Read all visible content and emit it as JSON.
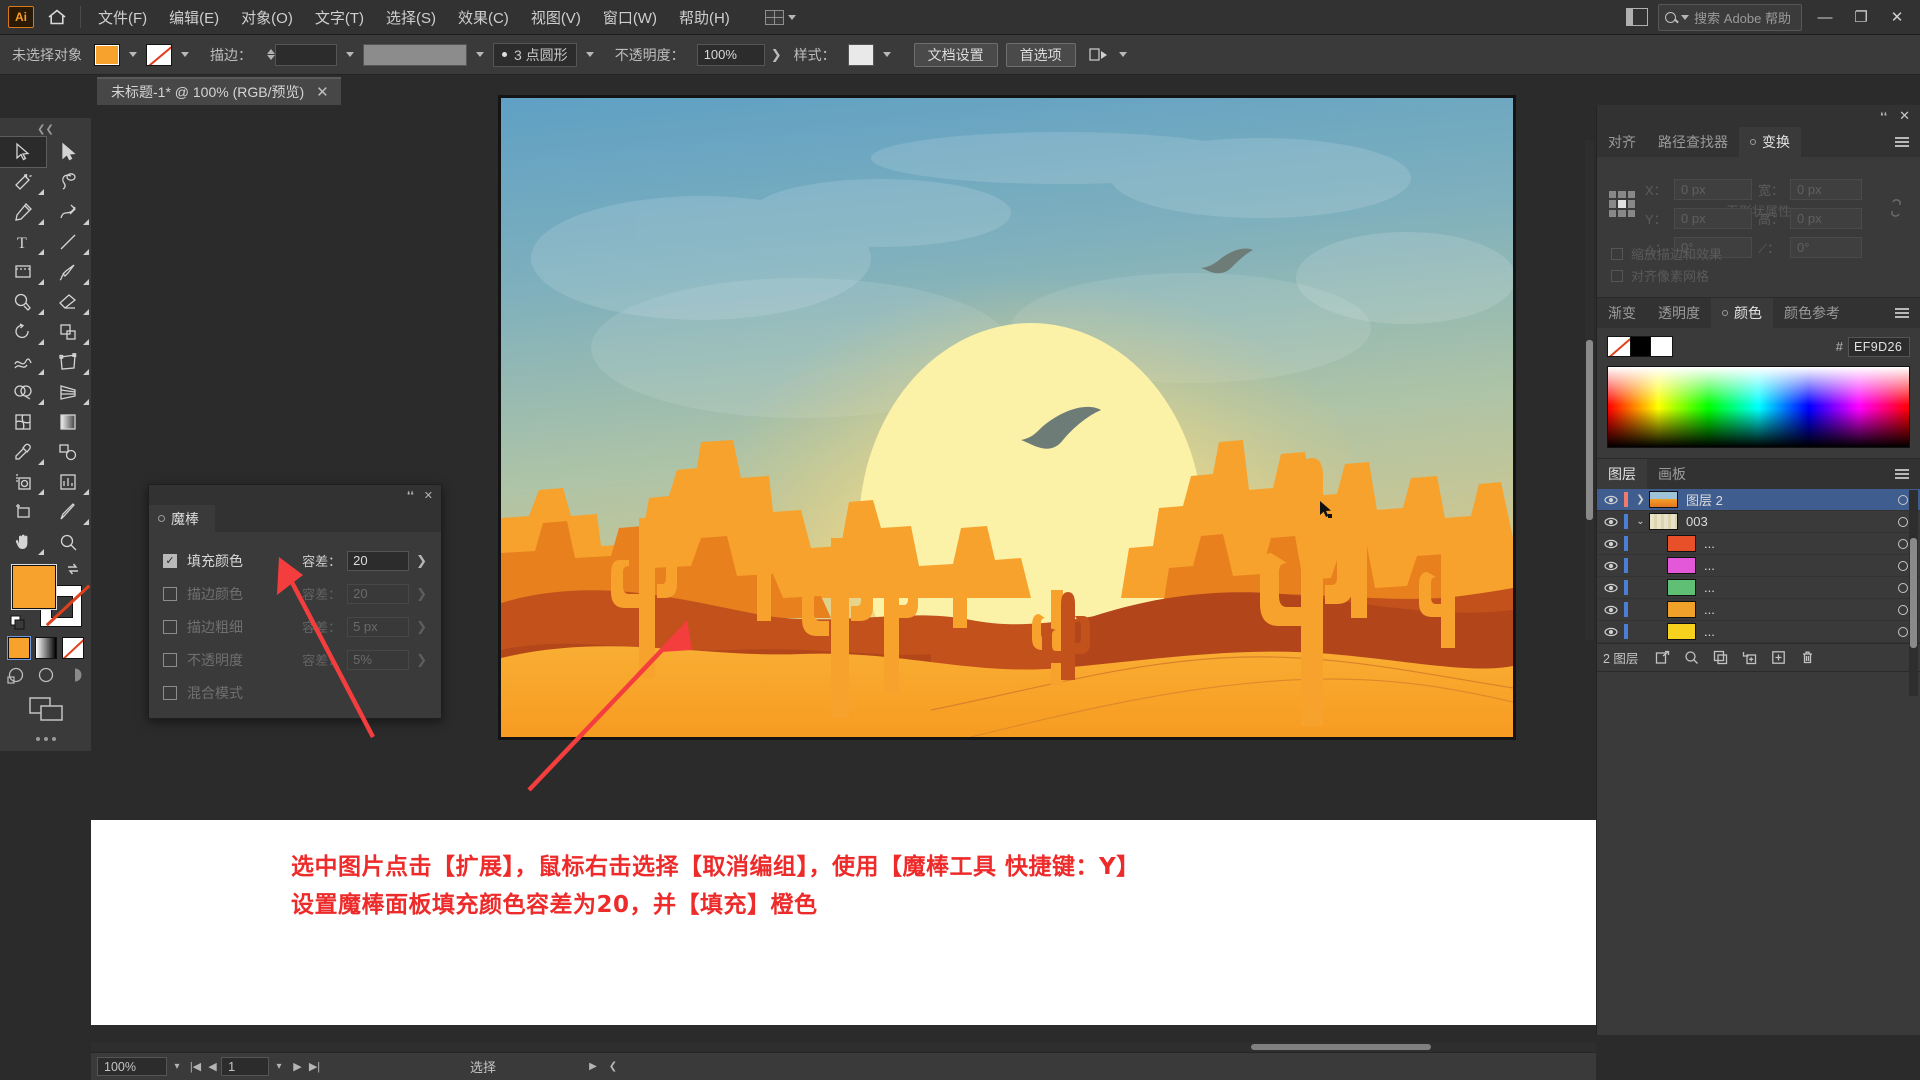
{
  "app": {
    "logo": "Ai",
    "home_icon": "home-icon",
    "workspace_icon": "workspace-grid-icon"
  },
  "menubar": {
    "items": [
      "文件(F)",
      "编辑(E)",
      "对象(O)",
      "文字(T)",
      "选择(S)",
      "效果(C)",
      "视图(V)",
      "窗口(W)",
      "帮助(H)"
    ],
    "search_placeholder": "搜索 Adobe 帮助",
    "window_buttons": [
      "—",
      "❐",
      "✕"
    ]
  },
  "controlbar": {
    "selection_status": "未选择对象",
    "fill_color": "#F7A22C",
    "stroke_label": "描边：",
    "stroke_weight": "",
    "profile_label": "3 点圆形",
    "opacity_label": "不透明度：",
    "opacity_value": "100%",
    "style_label": "样式：",
    "document_setup": "文档设置",
    "preferences": "首选项"
  },
  "document_tab": {
    "title": "未标题-1* @ 100% (RGB/预览)",
    "close": "✕"
  },
  "toolbar": {
    "tools": [
      {
        "name": "selection-tool",
        "selected": true
      },
      {
        "name": "direct-selection-tool",
        "selected": false
      },
      {
        "name": "magic-wand-tool",
        "selected": false
      },
      {
        "name": "lasso-tool",
        "selected": false
      },
      {
        "name": "pen-tool",
        "selected": false
      },
      {
        "name": "curvature-tool",
        "selected": false
      },
      {
        "name": "type-tool",
        "selected": false
      },
      {
        "name": "line-segment-tool",
        "selected": false
      },
      {
        "name": "rectangle-tool",
        "selected": false
      },
      {
        "name": "paintbrush-tool",
        "selected": false
      },
      {
        "name": "shaper-tool",
        "selected": false
      },
      {
        "name": "eraser-tool",
        "selected": false
      },
      {
        "name": "rotate-tool",
        "selected": false
      },
      {
        "name": "scale-tool",
        "selected": false
      },
      {
        "name": "width-tool",
        "selected": false
      },
      {
        "name": "free-transform-tool",
        "selected": false
      },
      {
        "name": "shape-builder-tool",
        "selected": false
      },
      {
        "name": "perspective-grid-tool",
        "selected": false
      },
      {
        "name": "mesh-tool",
        "selected": false
      },
      {
        "name": "gradient-tool",
        "selected": false
      },
      {
        "name": "eyedropper-tool",
        "selected": false
      },
      {
        "name": "blend-tool",
        "selected": false
      },
      {
        "name": "symbol-sprayer-tool",
        "selected": false
      },
      {
        "name": "column-graph-tool",
        "selected": false
      },
      {
        "name": "artboard-tool",
        "selected": false
      },
      {
        "name": "slice-tool",
        "selected": false
      },
      {
        "name": "hand-tool",
        "selected": false
      },
      {
        "name": "zoom-tool",
        "selected": false
      }
    ],
    "fill_color": "#F7A22C",
    "stroke_color": "none",
    "more_tools": "···"
  },
  "magic_wand_panel": {
    "tab_title": "魔棒",
    "collapse_icon": "collapse-icon",
    "close_icon": "✕",
    "rows": [
      {
        "label": "填充颜色",
        "checked": true,
        "tolerance_label": "容差：",
        "tolerance_value": "20",
        "enabled": true
      },
      {
        "label": "描边颜色",
        "checked": false,
        "tolerance_label": "容差：",
        "tolerance_value": "20",
        "enabled": false
      },
      {
        "label": "描边粗细",
        "checked": false,
        "tolerance_label": "容差：",
        "tolerance_value": "5 px",
        "enabled": false
      },
      {
        "label": "不透明度",
        "checked": false,
        "tolerance_label": "容差：",
        "tolerance_value": "5%",
        "enabled": false
      },
      {
        "label": "混合模式",
        "checked": false,
        "tolerance_label": "",
        "tolerance_value": "",
        "enabled": false
      }
    ]
  },
  "transform_panel": {
    "tabs": [
      "对齐",
      "路径查找器",
      "变换"
    ],
    "active_tab": "变换",
    "fields": {
      "x_label": "X：",
      "x_value": "0 px",
      "y_label": "Y：",
      "y_value": "0 px",
      "w_label": "宽：",
      "w_value": "0 px",
      "h_label": "高：",
      "h_value": "0 px",
      "angle_label": "△：",
      "angle_value": "0°",
      "shear_label": "⟋：",
      "shear_value": "0°"
    },
    "empty_text": "无形状属性",
    "scale_strokes": "缩放描边和效果",
    "align_pixel": "对齐像素网格",
    "link_icon": "link-broken-icon"
  },
  "color_panel": {
    "tabs": [
      "渐变",
      "透明度",
      "颜色",
      "颜色参考"
    ],
    "active_tab": "颜色",
    "hash": "#",
    "hex_value": "EF9D26",
    "none_swatch": "none-swatch",
    "black_swatch": "#000000",
    "white_swatch": "#FFFFFF"
  },
  "layers_panel": {
    "tabs": [
      "图层",
      "画板"
    ],
    "active_tab": "图层",
    "rows": [
      {
        "name": "图层 2",
        "selected": true,
        "indent": 0,
        "color": "#F07A6B",
        "disclosure": "right",
        "thumb": "artwork-thumb"
      },
      {
        "name": "003",
        "selected": false,
        "indent": 1,
        "color": "#4A7FD4",
        "disclosure": "down",
        "thumb": "group-thumb"
      },
      {
        "name": "...",
        "selected": false,
        "indent": 2,
        "color": "#4A7FD4",
        "disclosure": "",
        "thumb": "#E8502A"
      },
      {
        "name": "...",
        "selected": false,
        "indent": 2,
        "color": "#4A7FD4",
        "disclosure": "",
        "thumb": "#E357D9"
      },
      {
        "name": "...",
        "selected": false,
        "indent": 2,
        "color": "#4A7FD4",
        "disclosure": "",
        "thumb": "#5FBF74"
      },
      {
        "name": "...",
        "selected": false,
        "indent": 2,
        "color": "#4A7FD4",
        "disclosure": "",
        "thumb": "#F0A12A"
      },
      {
        "name": "...",
        "selected": false,
        "indent": 2,
        "color": "#4A7FD4",
        "disclosure": "",
        "thumb": "#F6D21F"
      }
    ],
    "footer_count": "2 图层",
    "footer_icons": [
      "locate-object-icon",
      "search-icon",
      "make-clipping-mask-icon",
      "create-sublayer-icon",
      "create-new-layer-icon",
      "delete-selection-icon"
    ]
  },
  "statusbar": {
    "zoom": "100%",
    "page": "1",
    "status_text": "选择",
    "first_icon": "|◀",
    "prev_icon": "◀",
    "next_icon": "▶",
    "last_icon": "▶|"
  },
  "annotation": {
    "line1": "选中图片点击【扩展】，鼠标右击选择【取消编组】，使用【魔棒工具 快捷键：Y】",
    "line2": "设置魔棒面板填充颜色容差为20，并【填充】橙色",
    "color": "#EE2B2B"
  },
  "artwork": {
    "title": "desert-sunset-illustration",
    "sky_top": "#6CA8C4",
    "sky_mid": "#9BBFB4",
    "sun": "#FBF2A8",
    "sand": "#F7A62B",
    "dune_dark": "#C2511C",
    "cactus": "#F5A32B"
  }
}
